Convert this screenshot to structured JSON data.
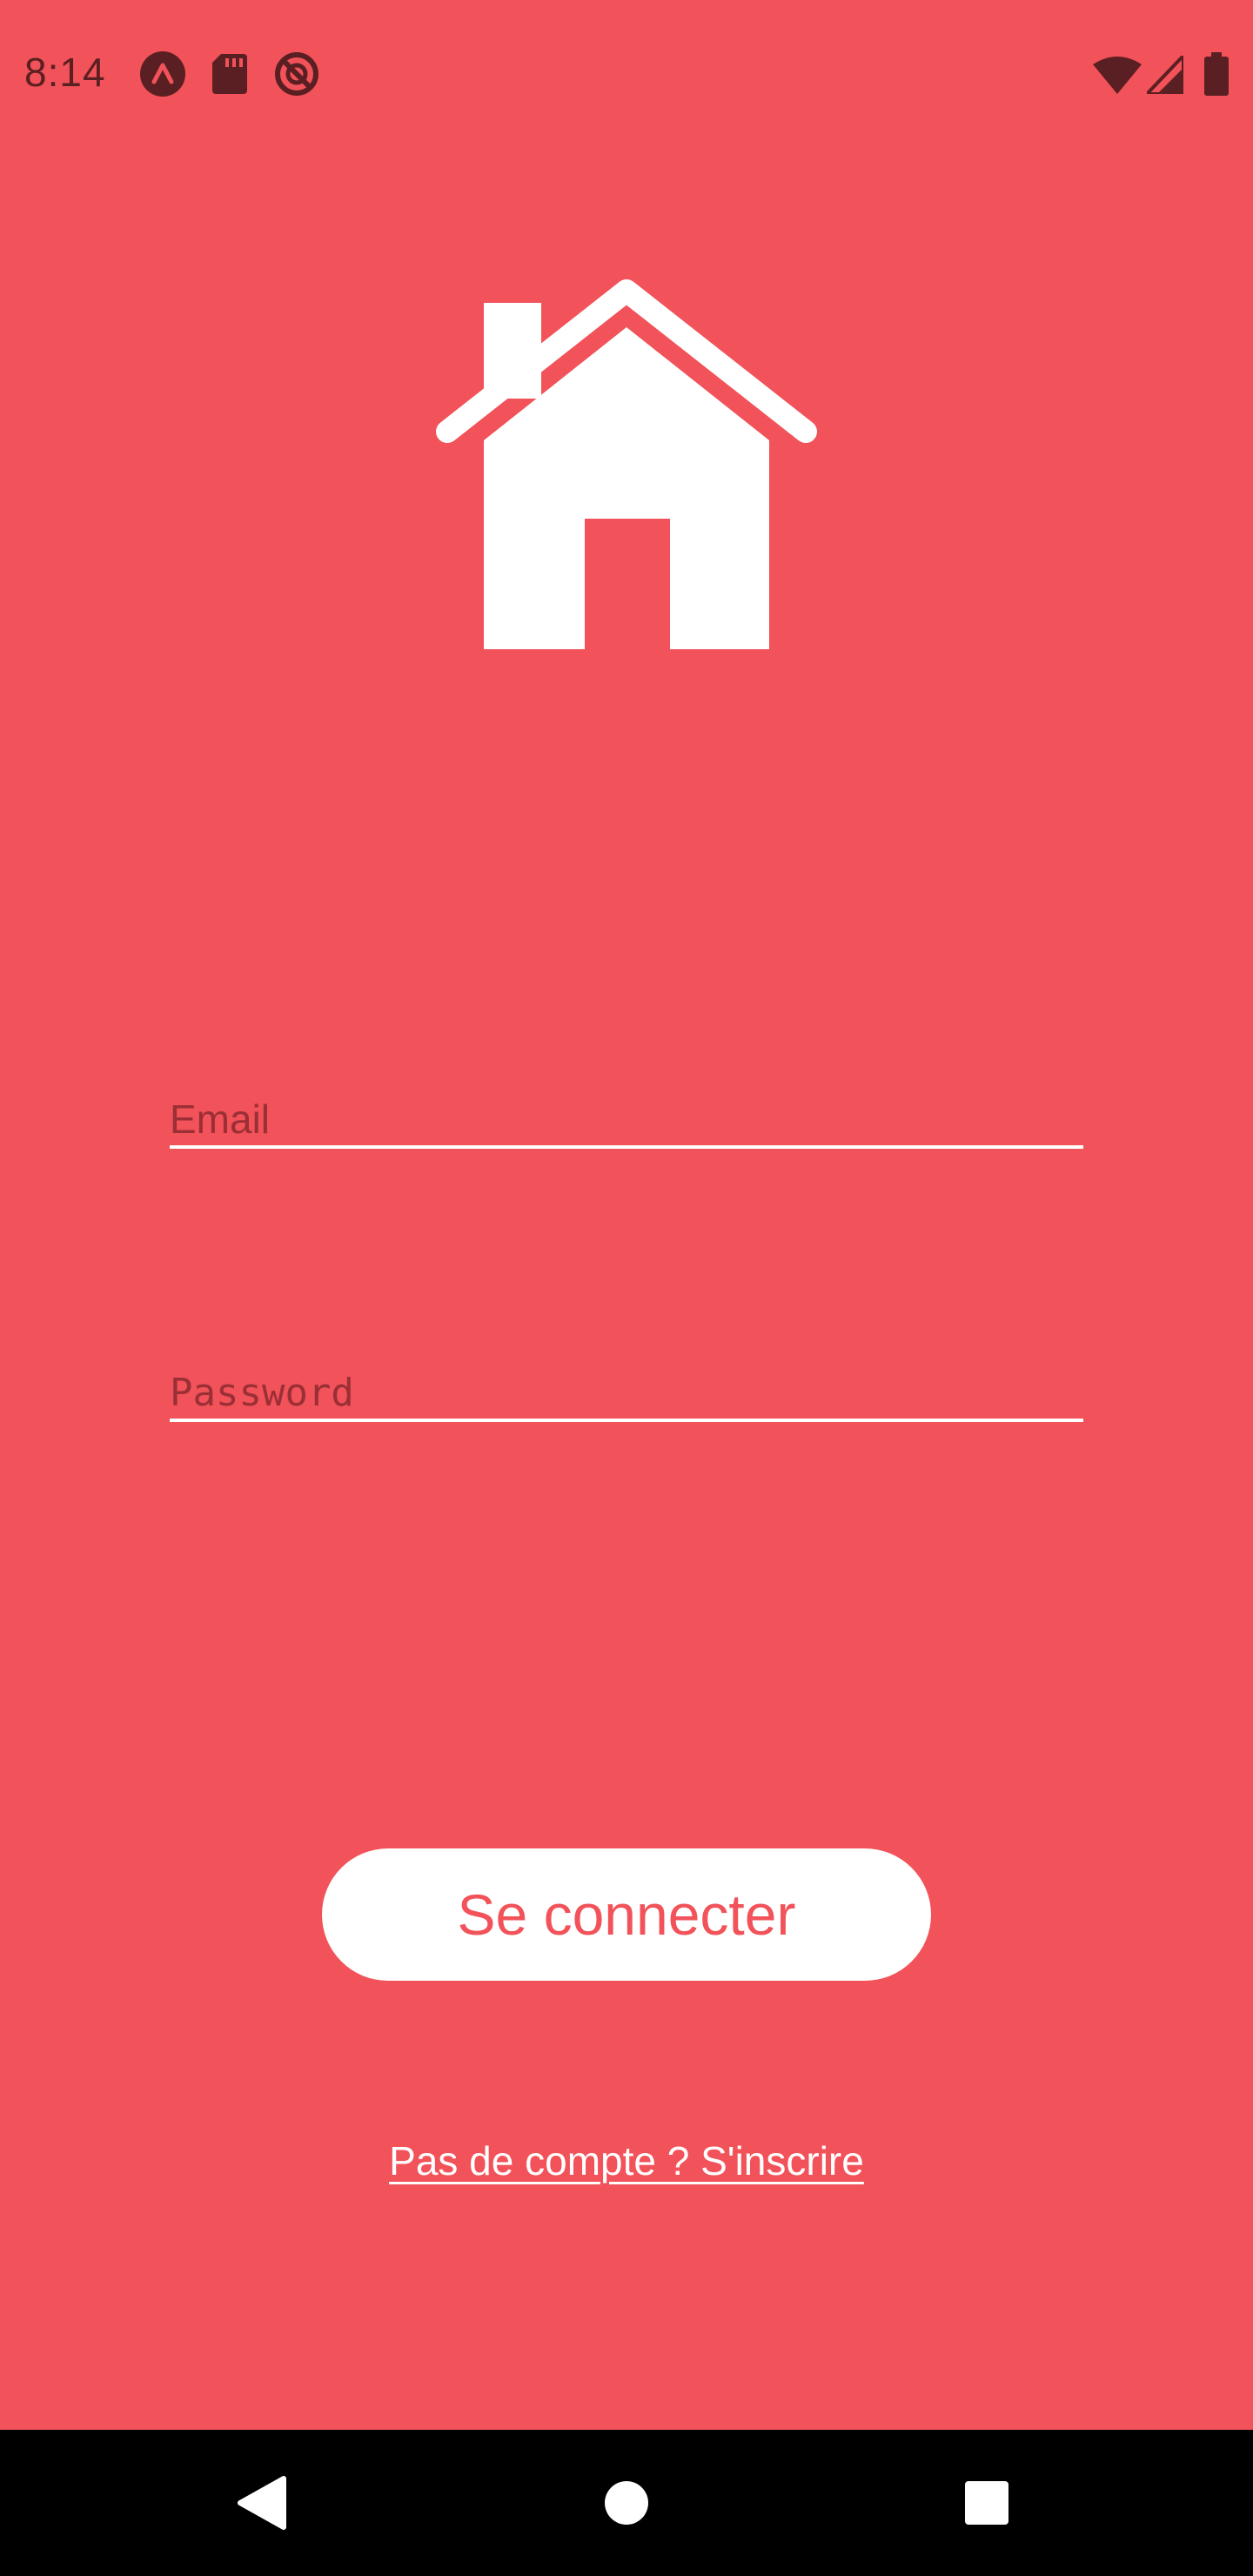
{
  "status_bar": {
    "time": "8:14",
    "left_icons": [
      "app-icon",
      "sd-card-icon",
      "do-not-disturb-icon"
    ],
    "right_icons": [
      "wifi-icon",
      "signal-icon",
      "battery-icon"
    ],
    "icon_color": "#5a1f22"
  },
  "logo": {
    "icon": "house-icon",
    "color": "#ffffff"
  },
  "form": {
    "email_placeholder": "Email",
    "password_placeholder": "Password",
    "submit_label": "Se connecter",
    "signup_link": "Pas de compte ? S'inscrire"
  },
  "nav_bar": {
    "icons": [
      "back-icon",
      "home-icon",
      "recents-icon"
    ]
  },
  "colors": {
    "background": "#F25259",
    "button_bg": "#ffffff",
    "button_text": "#F25259",
    "nav_bar": "#000000"
  }
}
